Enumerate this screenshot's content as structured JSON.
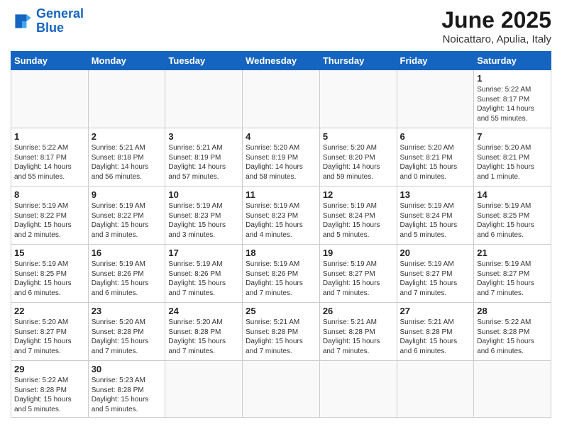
{
  "header": {
    "logo_line1": "General",
    "logo_line2": "Blue",
    "title": "June 2025",
    "location": "Noicattaro, Apulia, Italy"
  },
  "calendar": {
    "days_of_week": [
      "Sunday",
      "Monday",
      "Tuesday",
      "Wednesday",
      "Thursday",
      "Friday",
      "Saturday"
    ],
    "weeks": [
      [
        null,
        null,
        null,
        null,
        null,
        null,
        {
          "num": "1",
          "sunrise": "5:22 AM",
          "sunset": "8:17 PM",
          "daylight": "14 hours and 55 minutes."
        }
      ],
      [
        {
          "num": "1",
          "sunrise": "5:22 AM",
          "sunset": "8:17 PM",
          "daylight": "14 hours and 55 minutes."
        },
        {
          "num": "2",
          "sunrise": "5:21 AM",
          "sunset": "8:18 PM",
          "daylight": "14 hours and 56 minutes."
        },
        {
          "num": "3",
          "sunrise": "5:21 AM",
          "sunset": "8:19 PM",
          "daylight": "14 hours and 57 minutes."
        },
        {
          "num": "4",
          "sunrise": "5:20 AM",
          "sunset": "8:19 PM",
          "daylight": "14 hours and 58 minutes."
        },
        {
          "num": "5",
          "sunrise": "5:20 AM",
          "sunset": "8:20 PM",
          "daylight": "14 hours and 59 minutes."
        },
        {
          "num": "6",
          "sunrise": "5:20 AM",
          "sunset": "8:21 PM",
          "daylight": "15 hours and 0 minutes."
        },
        {
          "num": "7",
          "sunrise": "5:20 AM",
          "sunset": "8:21 PM",
          "daylight": "15 hours and 1 minute."
        }
      ],
      [
        {
          "num": "8",
          "sunrise": "5:19 AM",
          "sunset": "8:22 PM",
          "daylight": "15 hours and 2 minutes."
        },
        {
          "num": "9",
          "sunrise": "5:19 AM",
          "sunset": "8:22 PM",
          "daylight": "15 hours and 3 minutes."
        },
        {
          "num": "10",
          "sunrise": "5:19 AM",
          "sunset": "8:23 PM",
          "daylight": "15 hours and 3 minutes."
        },
        {
          "num": "11",
          "sunrise": "5:19 AM",
          "sunset": "8:23 PM",
          "daylight": "15 hours and 4 minutes."
        },
        {
          "num": "12",
          "sunrise": "5:19 AM",
          "sunset": "8:24 PM",
          "daylight": "15 hours and 5 minutes."
        },
        {
          "num": "13",
          "sunrise": "5:19 AM",
          "sunset": "8:24 PM",
          "daylight": "15 hours and 5 minutes."
        },
        {
          "num": "14",
          "sunrise": "5:19 AM",
          "sunset": "8:25 PM",
          "daylight": "15 hours and 6 minutes."
        }
      ],
      [
        {
          "num": "15",
          "sunrise": "5:19 AM",
          "sunset": "8:25 PM",
          "daylight": "15 hours and 6 minutes."
        },
        {
          "num": "16",
          "sunrise": "5:19 AM",
          "sunset": "8:26 PM",
          "daylight": "15 hours and 6 minutes."
        },
        {
          "num": "17",
          "sunrise": "5:19 AM",
          "sunset": "8:26 PM",
          "daylight": "15 hours and 7 minutes."
        },
        {
          "num": "18",
          "sunrise": "5:19 AM",
          "sunset": "8:26 PM",
          "daylight": "15 hours and 7 minutes."
        },
        {
          "num": "19",
          "sunrise": "5:19 AM",
          "sunset": "8:27 PM",
          "daylight": "15 hours and 7 minutes."
        },
        {
          "num": "20",
          "sunrise": "5:19 AM",
          "sunset": "8:27 PM",
          "daylight": "15 hours and 7 minutes."
        },
        {
          "num": "21",
          "sunrise": "5:19 AM",
          "sunset": "8:27 PM",
          "daylight": "15 hours and 7 minutes."
        }
      ],
      [
        {
          "num": "22",
          "sunrise": "5:20 AM",
          "sunset": "8:27 PM",
          "daylight": "15 hours and 7 minutes."
        },
        {
          "num": "23",
          "sunrise": "5:20 AM",
          "sunset": "8:28 PM",
          "daylight": "15 hours and 7 minutes."
        },
        {
          "num": "24",
          "sunrise": "5:20 AM",
          "sunset": "8:28 PM",
          "daylight": "15 hours and 7 minutes."
        },
        {
          "num": "25",
          "sunrise": "5:21 AM",
          "sunset": "8:28 PM",
          "daylight": "15 hours and 7 minutes."
        },
        {
          "num": "26",
          "sunrise": "5:21 AM",
          "sunset": "8:28 PM",
          "daylight": "15 hours and 7 minutes."
        },
        {
          "num": "27",
          "sunrise": "5:21 AM",
          "sunset": "8:28 PM",
          "daylight": "15 hours and 6 minutes."
        },
        {
          "num": "28",
          "sunrise": "5:22 AM",
          "sunset": "8:28 PM",
          "daylight": "15 hours and 6 minutes."
        }
      ],
      [
        {
          "num": "29",
          "sunrise": "5:22 AM",
          "sunset": "8:28 PM",
          "daylight": "15 hours and 5 minutes."
        },
        {
          "num": "30",
          "sunrise": "5:23 AM",
          "sunset": "8:28 PM",
          "daylight": "15 hours and 5 minutes."
        },
        null,
        null,
        null,
        null,
        null
      ]
    ]
  }
}
